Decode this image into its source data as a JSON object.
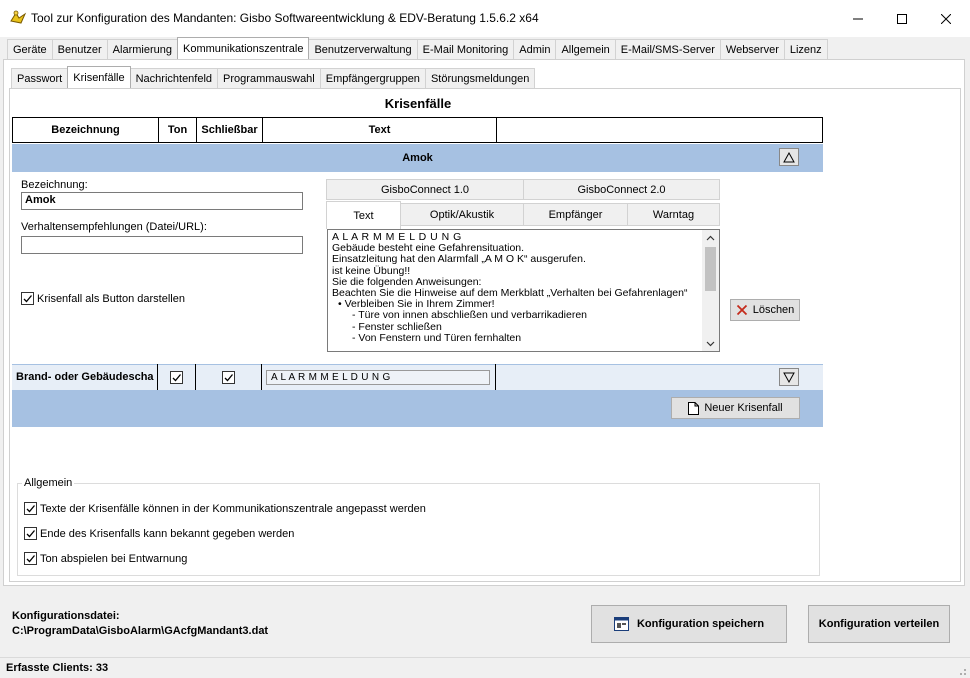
{
  "window": {
    "title": "Tool zur Konfiguration des Mandanten: Gisbo Softwareentwicklung & EDV-Beratung 1.5.6.2 x64"
  },
  "main_tabs": [
    {
      "label": "Geräte"
    },
    {
      "label": "Benutzer"
    },
    {
      "label": "Alarmierung"
    },
    {
      "label": "Kommunikationszentrale",
      "active": true
    },
    {
      "label": "Benutzerverwaltung"
    },
    {
      "label": "E-Mail Monitoring"
    },
    {
      "label": "Admin"
    },
    {
      "label": "Allgemein"
    },
    {
      "label": "E-Mail/SMS-Server"
    },
    {
      "label": "Webserver"
    },
    {
      "label": "Lizenz"
    }
  ],
  "sub_tabs": [
    {
      "label": "Passwort"
    },
    {
      "label": "Krisenfälle",
      "active": true
    },
    {
      "label": "Nachrichtenfeld"
    },
    {
      "label": "Programmauswahl"
    },
    {
      "label": "Empfängergruppen"
    },
    {
      "label": "Störungsmeldungen"
    }
  ],
  "section_title": "Krisenfälle",
  "grid_headers": {
    "bezeichnung": "Bezeichnung",
    "ton": "Ton",
    "schliessbar": "Schließbar",
    "text": "Text"
  },
  "amok": {
    "header": "Amok",
    "bezeichnung_label": "Bezeichnung:",
    "bezeichnung_value": "Amok",
    "verhalten_label": "Verhaltensempfehlungen (Datei/URL):",
    "verhalten_value": "",
    "button_checkbox_label": "Krisenfall als Button darstellen",
    "button_checked": true,
    "connect_tabs": [
      "GisboConnect 1.0",
      "GisboConnect 2.0"
    ],
    "detail_tabs": [
      "Text",
      "Optik/Akustik",
      "Empfänger",
      "Warntag"
    ],
    "text_lines": [
      "A L A R M M E L D U N G",
      "Gebäude besteht eine Gefahrensituation.",
      "Einsatzleitung hat den Alarmfall „A M O K“ ausgerufen.",
      "ist keine Übung!!",
      "Sie die folgenden Anweisungen:",
      "Beachten Sie die Hinweise auf dem Merkblatt „Verhalten bei Gefahrenlagen“",
      "• Verbleiben Sie in Ihrem Zimmer!",
      "- Türe von innen abschließen und verbarrikadieren",
      "- Fenster schließen",
      "- Von Fenstern und Türen fernhalten"
    ],
    "delete_label": "Löschen"
  },
  "brand_row": {
    "bezeichnung": "Brand- oder Gebäudescha",
    "ton_checked": true,
    "schliessbar_checked": true,
    "text": "A L A R M M E L D U N G"
  },
  "new_button_label": "Neuer Krisenfall",
  "allgemein": {
    "legend": "Allgemein",
    "options": [
      {
        "label": "Texte der Krisenfälle können in der Kommunikationszentrale angepasst werden",
        "checked": true
      },
      {
        "label": "Ende des Krisenfalls kann bekannt gegeben werden",
        "checked": true
      },
      {
        "label": "Ton abspielen bei Entwarnung",
        "checked": true
      }
    ]
  },
  "footer": {
    "config_label": "Konfigurationsdatei:",
    "config_path": "C:\\ProgramData\\GisboAlarm\\GAcfgMandant3.dat",
    "save_label": "Konfiguration speichern",
    "distribute_label": "Konfiguration verteilen"
  },
  "status": {
    "clients": "Erfasste Clients: 33"
  },
  "colors": {
    "accent_blue": "#a6c1e2",
    "delete_red": "#c42b1c"
  }
}
